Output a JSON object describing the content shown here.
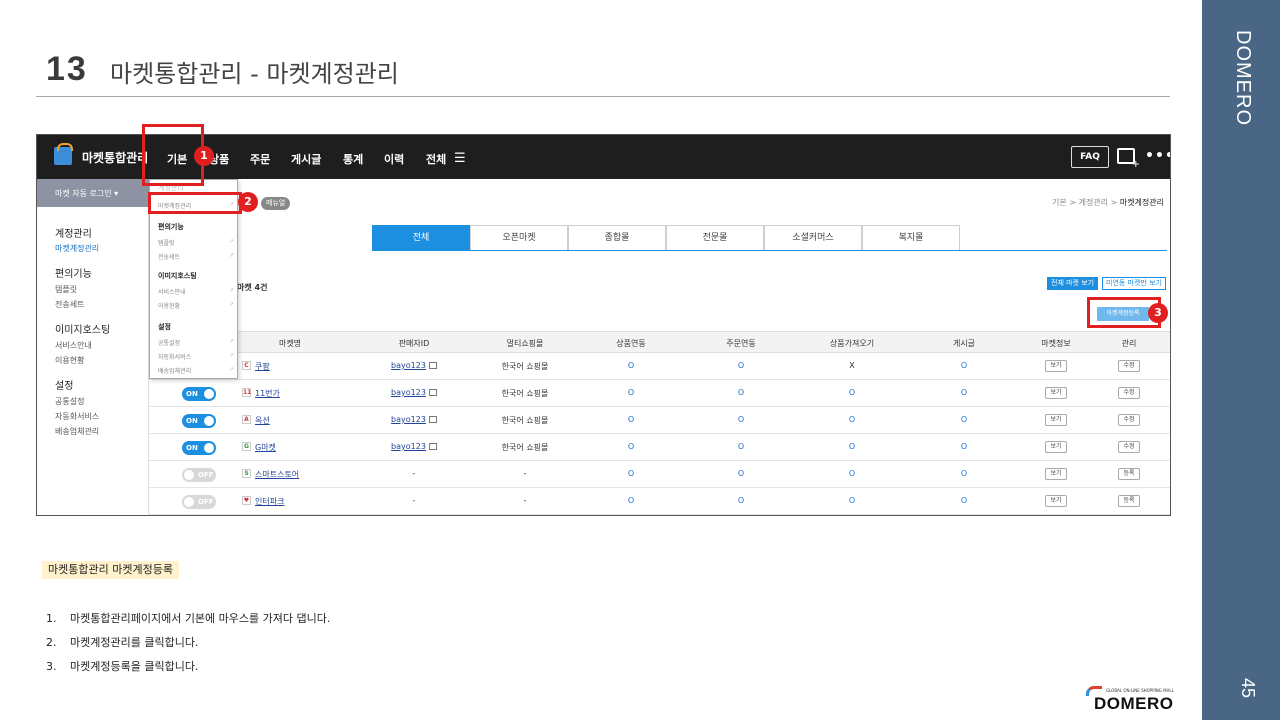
{
  "slide": {
    "number": "13",
    "title": "마켓통합관리 - 마켓계정관리",
    "brand_vertical": "DOMERO",
    "page_number": "45",
    "logo_word": "DOMERO",
    "logo_tagline": "GLOBAL ON-LINE SHOPPING MALL"
  },
  "app": {
    "logo_text": "마켓통합관리",
    "nav": [
      "기본",
      "상품",
      "주문",
      "게시글",
      "통계",
      "이력",
      "전체"
    ],
    "faq": "FAQ",
    "auto_login": "마켓 자동 로그인  ▾",
    "menu_badge": "메뉴얼",
    "breadcrumb": [
      "기본",
      ">",
      "계정관리",
      ">",
      "마켓계정관리"
    ]
  },
  "left_menu": [
    {
      "section": "계정관리",
      "items": [
        "마켓계정관리"
      ]
    },
    {
      "section": "편의기능",
      "items": [
        "템플릿",
        "전송세트"
      ]
    },
    {
      "section": "이미지호스팅",
      "items": [
        "서비스안내",
        "이용현황"
      ]
    },
    {
      "section": "설정",
      "items": [
        "공통설정",
        "자동화서비스",
        "배송업체관리"
      ]
    }
  ],
  "dropdown": {
    "header": "계정관리",
    "groups": [
      {
        "section": "",
        "items": [
          "마켓계정관리"
        ]
      },
      {
        "section": "편의기능",
        "items": [
          "템플릿",
          "전송세트"
        ]
      },
      {
        "section": "이미지호스팅",
        "items": [
          "서비스안내",
          "이용현황"
        ]
      },
      {
        "section": "설정",
        "items": [
          "공통설정",
          "자동화서비스",
          "배송업체관리"
        ]
      }
    ]
  },
  "tabs": [
    "전체",
    "오픈마켓",
    "종합몰",
    "전문몰",
    "소셜커머스",
    "복지몰"
  ],
  "active_tab": "전체",
  "count_text": "마켓 4건",
  "view_all": "전체 마켓 보기",
  "view_unlinked": "미연동 마켓만 보기",
  "register_button": "마켓계정등록",
  "table": {
    "headers": [
      "마켓명",
      "판매자ID",
      "멀티쇼핑몰",
      "상품연동",
      "주문연동",
      "상품가져오기",
      "게시글",
      "마켓정보",
      "관리"
    ],
    "rows": [
      {
        "toggle": "ON",
        "icon": "C",
        "icon_color": "#e03030",
        "name": "쿠팡",
        "seller": "bayo123",
        "multi": "한국어 쇼핑몰",
        "product": "O",
        "order": "O",
        "import": "X",
        "post": "O",
        "info": "보기",
        "manage": "수정"
      },
      {
        "toggle": "ON",
        "icon": "11",
        "icon_color": "#e03030",
        "name": "11번가",
        "seller": "bayo123",
        "multi": "한국어 쇼핑몰",
        "product": "O",
        "order": "O",
        "import": "O",
        "post": "O",
        "info": "보기",
        "manage": "수정"
      },
      {
        "toggle": "ON",
        "icon": "A",
        "icon_color": "#e03030",
        "name": "옥션",
        "seller": "bayo123",
        "multi": "한국어 쇼핑몰",
        "product": "O",
        "order": "O",
        "import": "O",
        "post": "O",
        "info": "보기",
        "manage": "수정"
      },
      {
        "toggle": "ON",
        "icon": "G",
        "icon_color": "#2a9a3a",
        "name": "G마켓",
        "seller": "bayo123",
        "multi": "한국어 쇼핑몰",
        "product": "O",
        "order": "O",
        "import": "O",
        "post": "O",
        "info": "보기",
        "manage": "수정"
      },
      {
        "toggle": "OFF",
        "icon": "S",
        "icon_color": "#2a9a3a",
        "name": "스마트스토어",
        "seller": "-",
        "multi": "-",
        "product": "O",
        "order": "O",
        "import": "O",
        "post": "O",
        "info": "보기",
        "manage": "등록"
      },
      {
        "toggle": "OFF",
        "icon": "♥",
        "icon_color": "#e03030",
        "name": "인터파크",
        "seller": "-",
        "multi": "-",
        "product": "O",
        "order": "O",
        "import": "O",
        "post": "O",
        "info": "보기",
        "manage": "등록"
      }
    ]
  },
  "callouts": [
    "1",
    "2",
    "3"
  ],
  "description": {
    "label": "마켓통합관리  마켓계정등록",
    "steps": [
      {
        "n": "1.",
        "text": "마켓통합관리페이지에서  기본에 마우스를 가져다 댑니다."
      },
      {
        "n": "2.",
        "text": "마켓계정관리를  클릭합니다."
      },
      {
        "n": "3.",
        "text": "마켓계정등록을  클릭합니다."
      }
    ]
  }
}
